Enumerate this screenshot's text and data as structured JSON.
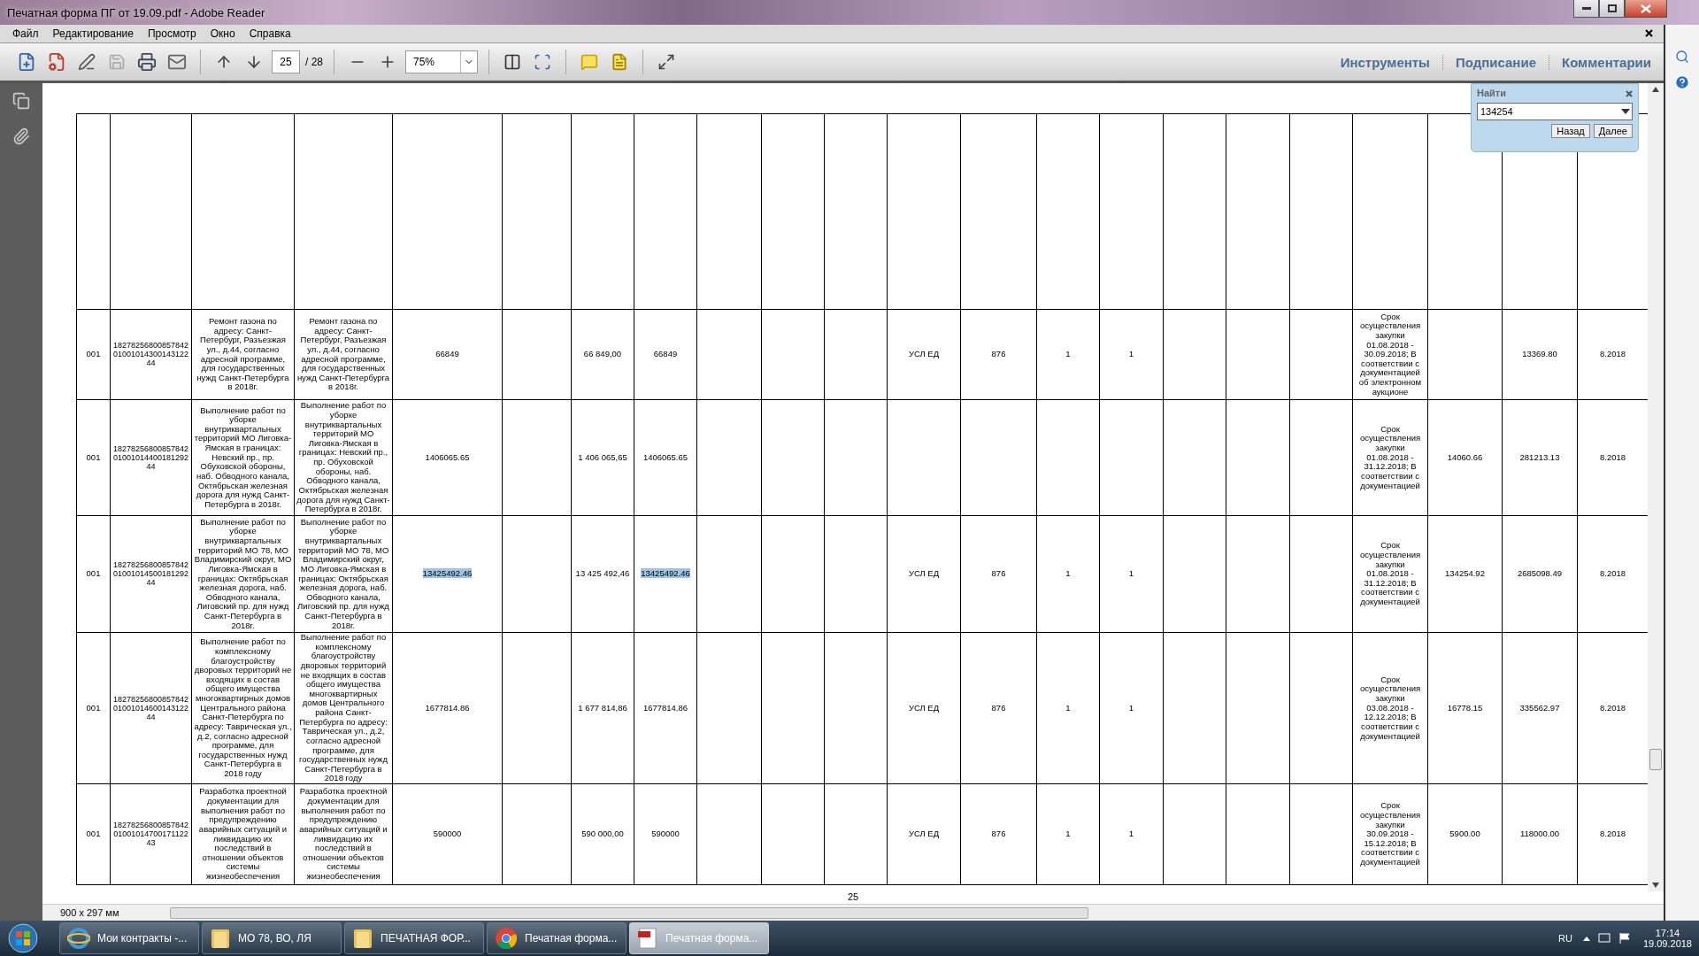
{
  "window": {
    "title": "Печатная форма ПГ от 19.09.pdf - Adobe Reader"
  },
  "menu": [
    "Файл",
    "Редактирование",
    "Просмотр",
    "Окно",
    "Справка"
  ],
  "toolbar": {
    "page": "25",
    "page_count": "/ 28",
    "zoom": "75%",
    "panels": [
      "Инструменты",
      "Подписание",
      "Комментарии"
    ]
  },
  "find": {
    "title": "Найти",
    "value": "134254",
    "buttons": [
      "Назад",
      "Далее"
    ]
  },
  "table": {
    "rows": [
      {
        "cells": [
          {
            "text": "001",
            "highlighted": false
          },
          {
            "text": "182782568008578420100101430014312244",
            "highlighted": false
          },
          {
            "text": "Ремонт газона по адресу: Санкт-Петербург, Разъезжая ул., д.44, согласно адресной программе, для государственных нужд Санкт-Петербурга в 2018г.",
            "highlighted": false
          },
          {
            "text": "Ремонт газона по адресу: Санкт-Петербург, Разъезжая ул., д.44, согласно адресной программе, для государственных нужд Санкт-Петербурга в 2018г.",
            "highlighted": false
          },
          {
            "text": "66849",
            "highlighted": false
          },
          null,
          {
            "text": "66 849,00",
            "highlighted": false
          },
          {
            "text": "66849",
            "highlighted": false
          },
          null,
          null,
          null,
          {
            "text": "УСЛ ЕД",
            "highlighted": false
          },
          {
            "text": "876",
            "highlighted": false
          },
          {
            "text": "1",
            "highlighted": false
          },
          {
            "text": "1",
            "highlighted": false
          },
          null,
          null,
          null,
          {
            "text": "Срок осуществления закупки 01.08.2018 - 30.09.2018; В соответствии с документацией об электронном аукционе",
            "highlighted": false
          },
          null,
          {
            "text": "13369.80",
            "highlighted": false
          },
          {
            "text": "8.2018",
            "highlighted": false
          }
        ]
      },
      {
        "cells": [
          {
            "text": "001",
            "highlighted": false
          },
          {
            "text": "182782568008578420100101440018129244",
            "highlighted": false
          },
          {
            "text": "Выполнение работ по уборке внутриквартальных территорий МО Лиговка-Ямская в границах: Невский пр., пр. Обуховской обороны, наб. Обводного канала, Октябрьская железная дорога для нужд Санкт-Петербурга в 2018г.",
            "highlighted": false
          },
          {
            "text": "Выполнение работ по уборке внутриквартальных территорий МО Лиговка-Ямская в границах: Невский пр., пр. Обуховской обороны, наб. Обводного канала, Октябрьская железная дорога для нужд Санкт-Петербурга в 2018г.",
            "highlighted": false
          },
          {
            "text": "1406065.65",
            "highlighted": false
          },
          null,
          {
            "text": "1 406 065,65",
            "highlighted": false
          },
          {
            "text": "1406065.65",
            "highlighted": false
          },
          null,
          null,
          null,
          null,
          null,
          null,
          null,
          null,
          null,
          null,
          {
            "text": "Срок осуществления закупки 01.08.2018 - 31.12.2018; В соответствии с документацией",
            "highlighted": false
          },
          {
            "text": "14060.66",
            "highlighted": false
          },
          {
            "text": "281213.13",
            "highlighted": false
          },
          {
            "text": "8.2018",
            "highlighted": false
          }
        ]
      },
      {
        "cells": [
          {
            "text": "001",
            "highlighted": false
          },
          {
            "text": "182782568008578420100101450018129244",
            "highlighted": false
          },
          {
            "text": "Выполнение работ по уборке внутриквартальных территорий МО 78, МО Владимирский округ, МО Лиговка-Ямская в границах: Октябрьская железная дорога, наб. Обводного канала, Лиговский пр. для нужд Санкт-Петербурга в 2018г.",
            "highlighted": false
          },
          {
            "text": "Выполнение работ по уборке внутриквартальных территорий МО 78, МО Владимирский округ, МО Лиговка-Ямская в границах: Октябрьская железная дорога, наб. Обводного канала, Лиговский пр. для нужд Санкт-Петербурга в 2018г.",
            "highlighted": false
          },
          {
            "text": "13425492.46",
            "highlighted": true
          },
          null,
          {
            "text": "13 425 492,46",
            "highlighted": false
          },
          {
            "text": "13425492.46",
            "highlighted": true
          },
          null,
          null,
          null,
          {
            "text": "УСЛ ЕД",
            "highlighted": false
          },
          {
            "text": "876",
            "highlighted": false
          },
          {
            "text": "1",
            "highlighted": false
          },
          {
            "text": "1",
            "highlighted": false
          },
          null,
          null,
          null,
          {
            "text": "Срок осуществления закупки 01.08.2018 - 31.12.2018; В соответствии с документацией",
            "highlighted": false
          },
          {
            "text": "134254.92",
            "highlighted": false
          },
          {
            "text": "2685098.49",
            "highlighted": false
          },
          {
            "text": "8.2018",
            "highlighted": false
          }
        ]
      },
      {
        "cells": [
          {
            "text": "001",
            "highlighted": false
          },
          {
            "text": "182782568008578420100101460014312244",
            "highlighted": false
          },
          {
            "text": "Выполнение работ по комплексному благоустройству дворовых территорий не входящих в состав общего имущества многоквартирных домов Центрального района Санкт-Петербурга по адресу: Таврическая ул., д.2, согласно адресной программе, для государственных нужд Санкт-Петербурга в 2018 году",
            "highlighted": false
          },
          {
            "text": "Выполнение работ по комплексному благоустройству дворовых территорий не входящих в состав общего имущества многоквартирных домов Центрального района Санкт-Петербурга по адресу: Таврическая ул., д.2, согласно адресной программе, для государственных нужд Санкт-Петербурга в 2018 году",
            "highlighted": false
          },
          {
            "text": "1677814.86",
            "highlighted": false
          },
          null,
          {
            "text": "1 677 814,86",
            "highlighted": false
          },
          {
            "text": "1677814.86",
            "highlighted": false
          },
          null,
          null,
          null,
          {
            "text": "УСЛ ЕД",
            "highlighted": false
          },
          {
            "text": "876",
            "highlighted": false
          },
          {
            "text": "1",
            "highlighted": false
          },
          {
            "text": "1",
            "highlighted": false
          },
          null,
          null,
          null,
          {
            "text": "Срок осуществления закупки 03.08.2018 - 12.12.2018; В соответствии с документацией",
            "highlighted": false
          },
          {
            "text": "16778.15",
            "highlighted": false
          },
          {
            "text": "335562.97",
            "highlighted": false
          },
          {
            "text": "8.2018",
            "highlighted": false
          }
        ]
      },
      {
        "cells": [
          {
            "text": "001",
            "highlighted": false
          },
          {
            "text": "182782568008578420100101470017112243",
            "highlighted": false
          },
          {
            "text": "Разработка проектной документации для выполнения работ по предупреждению аварийных ситуаций и ликвидацию их последствий в отношении объектов системы жизнеобеспечения",
            "highlighted": false
          },
          {
            "text": "Разработка проектной документации для выполнения работ по предупреждению аварийных ситуаций и ликвидацию их последствий в отношении объектов системы жизнеобеспечения",
            "highlighted": false
          },
          {
            "text": "590000",
            "highlighted": false
          },
          null,
          {
            "text": "590 000,00",
            "highlighted": false
          },
          {
            "text": "590000",
            "highlighted": false
          },
          null,
          null,
          null,
          {
            "text": "УСЛ ЕД",
            "highlighted": false
          },
          {
            "text": "876",
            "highlighted": false
          },
          {
            "text": "1",
            "highlighted": false
          },
          {
            "text": "1",
            "highlighted": false
          },
          null,
          null,
          null,
          {
            "text": "Срок осуществления закупки 30.09.2018 - 15.12.2018; В соответствии с документацией",
            "highlighted": false
          },
          {
            "text": "5900.00",
            "highlighted": false
          },
          {
            "text": "118000.00",
            "highlighted": false
          },
          {
            "text": "8.2018",
            "highlighted": false
          }
        ]
      }
    ]
  },
  "page_label": "25",
  "page_size": "900 x 297 мм",
  "taskbar": {
    "items": [
      {
        "label": "Мои контракты -...",
        "kind": "ie",
        "selected": false
      },
      {
        "label": "МО 78, ВО, ЛЯ",
        "kind": "folder",
        "selected": false
      },
      {
        "label": "ПЕЧАТНАЯ ФОР...",
        "kind": "folder",
        "selected": false
      },
      {
        "label": "Печатная форма...",
        "kind": "chrome",
        "selected": false
      },
      {
        "label": "Печатная форма...",
        "kind": "pdf",
        "selected": true
      }
    ],
    "language": "RU",
    "time": "17:14",
    "date": "19.09.2018"
  }
}
